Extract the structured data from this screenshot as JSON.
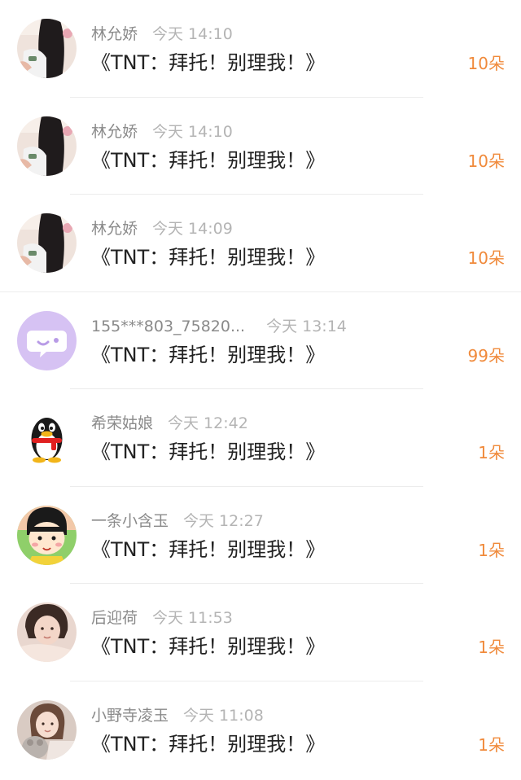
{
  "colors": {
    "amount_orange": "#f08a3b",
    "name_gray": "#8a8a8a",
    "time_gray": "#b4b4b4",
    "title_dark": "#222222"
  },
  "items": [
    {
      "name": "林允娇",
      "time": "今天 14:10",
      "title": "《TNT：拜托！别理我！》",
      "amount": "10朵",
      "avatar_icon": "girl-photo-avatar-icon"
    },
    {
      "name": "林允娇",
      "time": "今天 14:10",
      "title": "《TNT：拜托！别理我！》",
      "amount": "10朵",
      "avatar_icon": "girl-photo-avatar-icon"
    },
    {
      "name": "林允娇",
      "time": "今天 14:09",
      "title": "《TNT：拜托！别理我！》",
      "amount": "10朵",
      "avatar_icon": "girl-photo-avatar-icon"
    },
    {
      "name": "155***803_75820...",
      "time": "今天 13:14",
      "title": "《TNT：拜托！别理我！》",
      "amount": "99朵",
      "avatar_icon": "chat-bubble-avatar-icon"
    },
    {
      "name": "希荣姑娘",
      "time": "今天 12:42",
      "title": "《TNT：拜托！别理我！》",
      "amount": "1朵",
      "avatar_icon": "qq-penguin-avatar-icon"
    },
    {
      "name": "一条小含玉",
      "time": "今天 12:27",
      "title": "《TNT：拜托！别理我！》",
      "amount": "1朵",
      "avatar_icon": "cartoon-girl-avatar-icon"
    },
    {
      "name": "后迎荷",
      "time": "今天 11:53",
      "title": "《TNT：拜托！别理我！》",
      "amount": "1朵",
      "avatar_icon": "woman-photo-avatar-icon"
    },
    {
      "name": "小野寺凌玉",
      "time": "今天 11:08",
      "title": "《TNT：拜托！别理我！》",
      "amount": "1朵",
      "avatar_icon": "girl-with-toy-avatar-icon"
    }
  ]
}
